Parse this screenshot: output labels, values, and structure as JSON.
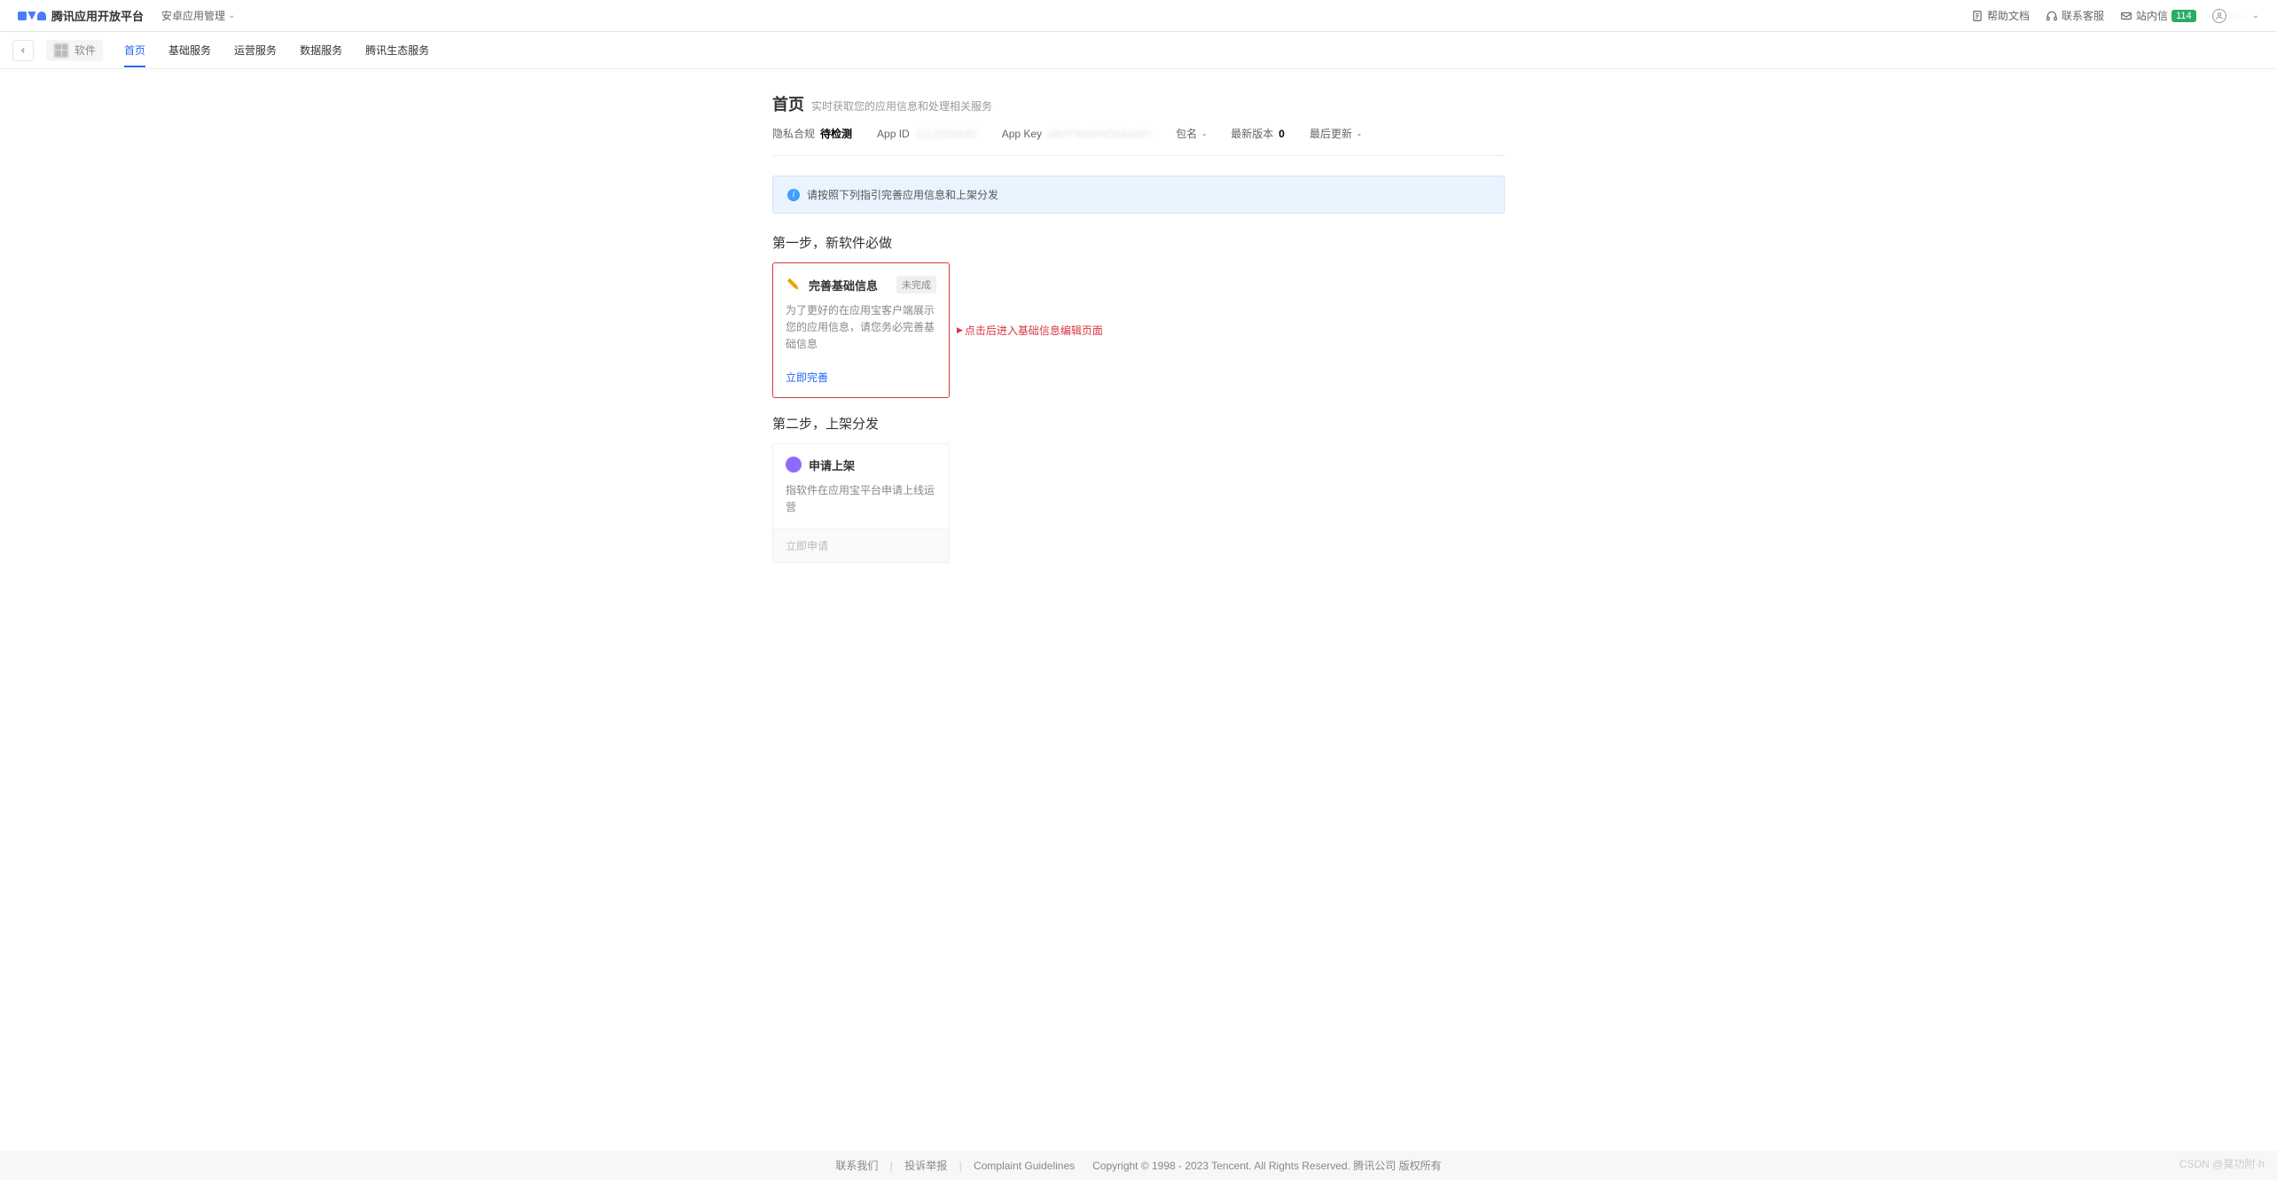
{
  "header": {
    "logo_text": "腾讯应用开放平台",
    "management_dropdown": "安卓应用管理",
    "links": {
      "help_docs": "帮助文档",
      "contact_cs": "联系客服",
      "inbox": "站内信",
      "inbox_count": "114"
    },
    "user_placeholder": "···"
  },
  "subnav": {
    "app_chip": "软件",
    "tabs": [
      "首页",
      "基础服务",
      "运营服务",
      "数据服务",
      "腾讯生态服务"
    ],
    "active_index": 0
  },
  "page": {
    "title": "首页",
    "subtitle": "实时获取您的应用信息和处理相关服务"
  },
  "meta": {
    "privacy_label": "隐私合规",
    "privacy_value": "待检测",
    "appid_label": "App ID",
    "appid_value": "1112320430",
    "appkey_label": "App Key",
    "appkey_value": "uBsY9mGHOskomH",
    "package_label": "包名",
    "package_value": "-",
    "version_label": "最新版本",
    "version_value": "0",
    "lastupdate_label": "最后更新",
    "lastupdate_value": "-"
  },
  "alert": {
    "text": "请按照下列指引完善应用信息和上架分发"
  },
  "step1": {
    "title": "第一步，新软件必做",
    "card": {
      "title": "完善基础信息",
      "status": "未完成",
      "desc": "为了更好的在应用宝客户端展示您的应用信息，请您务必完善基础信息",
      "action": "立即完善"
    },
    "annotation": "点击后进入基础信息编辑页面"
  },
  "step2": {
    "title": "第二步，上架分发",
    "card": {
      "title": "申请上架",
      "desc": "指软件在应用宝平台申请上线运营",
      "action": "立即申请"
    }
  },
  "footer": {
    "contact": "联系我们",
    "report": "投诉举报",
    "guidelines": "Complaint Guidelines",
    "copyright": "Copyright © 1998 - 2023 Tencent. All Rights Reserved. 腾讯公司 版权所有"
  },
  "watermark": "CSDN @莫功附·h"
}
